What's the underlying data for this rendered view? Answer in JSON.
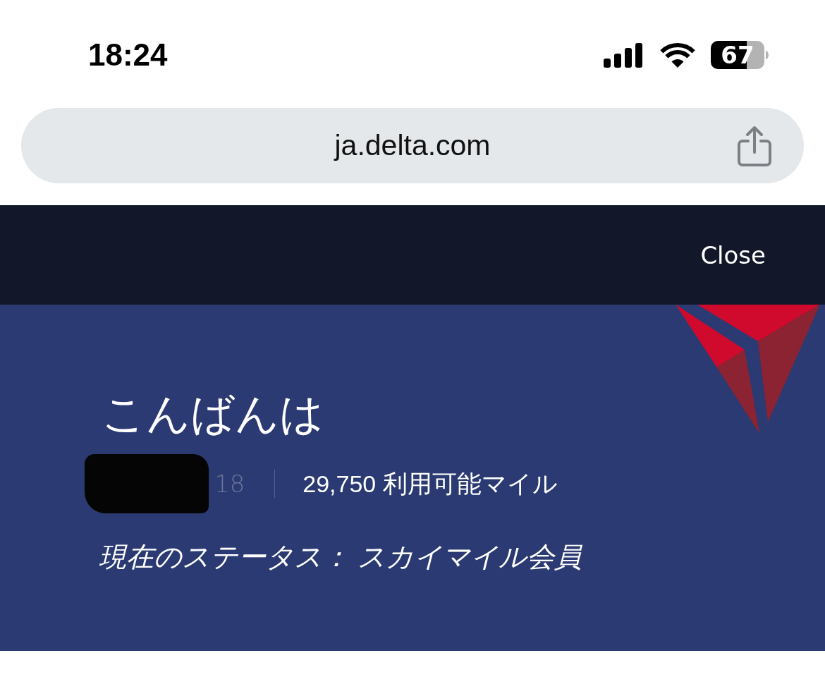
{
  "status_bar": {
    "time": "18:24",
    "battery_percent": "67"
  },
  "browser": {
    "url": "ja.delta.com"
  },
  "nav": {
    "close_label": "Close"
  },
  "account": {
    "greeting": "こんばんは",
    "member_number_fragment": "18",
    "miles_value": "29,750",
    "miles_label": "利用可能マイル",
    "status_text": "現在のステータス： スカイマイル会員"
  }
}
